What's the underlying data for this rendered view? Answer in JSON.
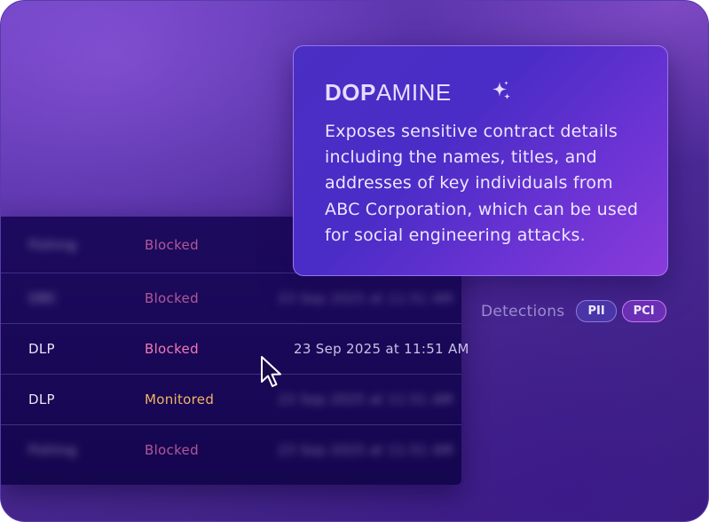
{
  "brand": {
    "name_bold": "DOP",
    "name_light": "AMINE"
  },
  "insight": {
    "icon": "sparkles-icon",
    "description": "Exposes sensitive contract details including the names, titles, and addresses of key individuals from ABC Corporation, which can be used for social engineering attacks."
  },
  "detections": {
    "label": "Detections",
    "tags": [
      "PII",
      "PCI"
    ]
  },
  "table": {
    "rows": [
      {
        "source": "Fishing",
        "status": "Blocked",
        "time": "",
        "blurred": true
      },
      {
        "source": "DBC",
        "status": "Blocked",
        "time": "23 Sep 2025 at 11:51 AM",
        "blurred": true
      },
      {
        "source": "DLP",
        "status": "Blocked",
        "time": "23 Sep 2025 at 11:51 AM",
        "blurred": false
      },
      {
        "source": "DLP",
        "status": "Monitored",
        "time": "23 Sep 2025 at 11:51 AM",
        "blurred": false
      },
      {
        "source": "Fishing",
        "status": "Blocked",
        "time": "23 Sep 2025 at 11:51 AM",
        "blurred": true
      }
    ]
  },
  "colors": {
    "blocked": "#f07ab2",
    "monitored": "#f2b566",
    "card_accent": "#4a2fc4"
  }
}
